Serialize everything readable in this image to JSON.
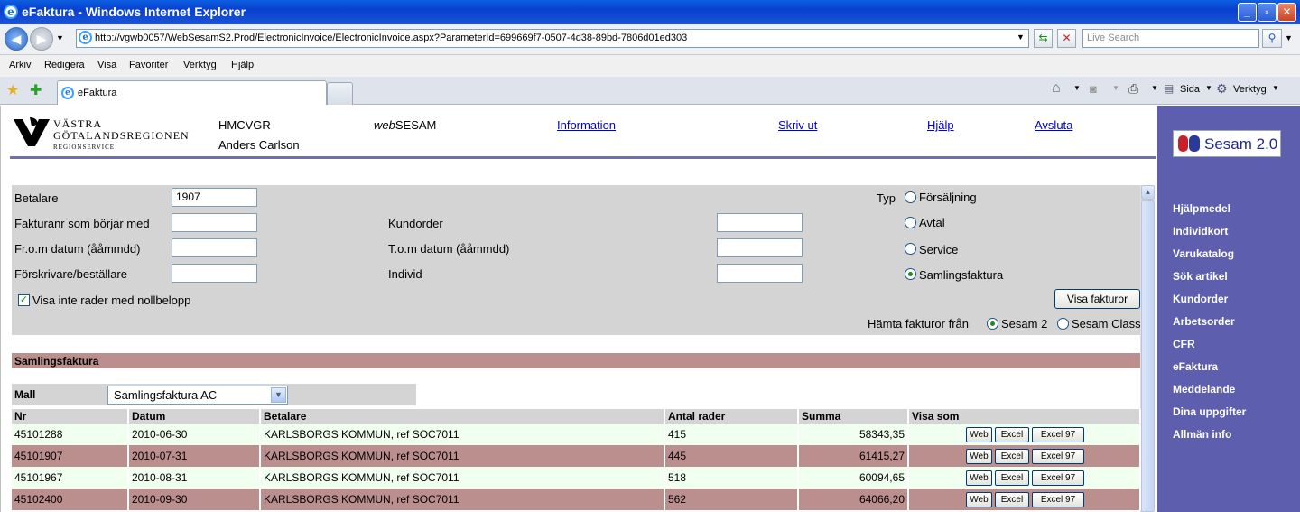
{
  "window": {
    "title": "eFaktura - Windows Internet Explorer",
    "minimize": "_",
    "maximize": "▫",
    "close": "✕"
  },
  "address": {
    "url": "http://vgwb0057/WebSesamS2.Prod/ElectronicInvoice/ElectronicInvoice.aspx?ParameterId=699669f7-0507-4d38-89bd-7806d01ed303",
    "search_placeholder": "Live Search"
  },
  "menu": [
    "Arkiv",
    "Redigera",
    "Visa",
    "Favoriter",
    "Verktyg",
    "Hjälp"
  ],
  "tab": {
    "label": "eFaktura"
  },
  "toolbar": {
    "page_label": "Sida",
    "tools_label": "Verktyg"
  },
  "header": {
    "org_line1": "VÄSTRA",
    "org_line2": "GÖTALANDSREGIONEN",
    "org_line3": "REGIONSERVICE",
    "unit": "HMCVGR",
    "user": "Anders Carlson",
    "app_prefix": "web",
    "app_name": "SESAM",
    "links": {
      "information": "Information",
      "print": "Skriv ut",
      "help": "Hjälp",
      "logout": "Avsluta"
    }
  },
  "sidebar": {
    "brand": "Sesam 2.0",
    "items": [
      "Hjälpmedel",
      "Individkort",
      "Varukatalog",
      "Sök artikel",
      "Kundorder",
      "Arbetsorder",
      "CFR",
      "eFaktura",
      "Meddelande",
      "Dina uppgifter",
      "Allmän info"
    ]
  },
  "filter": {
    "payer_label": "Betalare",
    "payer_value": "1907",
    "invoice_label": "Fakturanr som börjar med",
    "from_label": "Fr.o.m datum (ååmmdd)",
    "prescriber_label": "Förskrivare/beställare",
    "customer_order_label": "Kundorder",
    "to_label": "T.o.m datum (ååmmdd)",
    "individual_label": "Individ",
    "type_label": "Typ",
    "types": [
      "Försäljning",
      "Avtal",
      "Service",
      "Samlingsfaktura"
    ],
    "selected_type": "Samlingsfaktura",
    "hide_zero_label": "Visa inte rader med nollbelopp",
    "hide_zero_checked": true,
    "show_button": "Visa fakturor",
    "fetch_label": "Hämta fakturor från",
    "sources": [
      "Sesam 2",
      "Sesam Class"
    ],
    "selected_source": "Sesam 2"
  },
  "results": {
    "section_title": "Samlingsfaktura",
    "template_label": "Mall",
    "template_value": "Samlingsfaktura AC",
    "columns": [
      "Nr",
      "Datum",
      "Betalare",
      "Antal rader",
      "Summa",
      "Visa som"
    ],
    "export_buttons": [
      "Web",
      "Excel",
      "Excel 97"
    ],
    "rows": [
      {
        "nr": "45101288",
        "date": "2010-06-30",
        "payer": "KARLSBORGS KOMMUN, ref SOC7011",
        "count": "415",
        "sum": "58343,35"
      },
      {
        "nr": "45101907",
        "date": "2010-07-31",
        "payer": "KARLSBORGS KOMMUN, ref SOC7011",
        "count": "445",
        "sum": "61415,27"
      },
      {
        "nr": "45101967",
        "date": "2010-08-31",
        "payer": "KARLSBORGS KOMMUN, ref SOC7011",
        "count": "518",
        "sum": "60094,65"
      },
      {
        "nr": "45102400",
        "date": "2010-09-30",
        "payer": "KARLSBORGS KOMMUN, ref SOC7011",
        "count": "562",
        "sum": "64066,20"
      }
    ]
  }
}
